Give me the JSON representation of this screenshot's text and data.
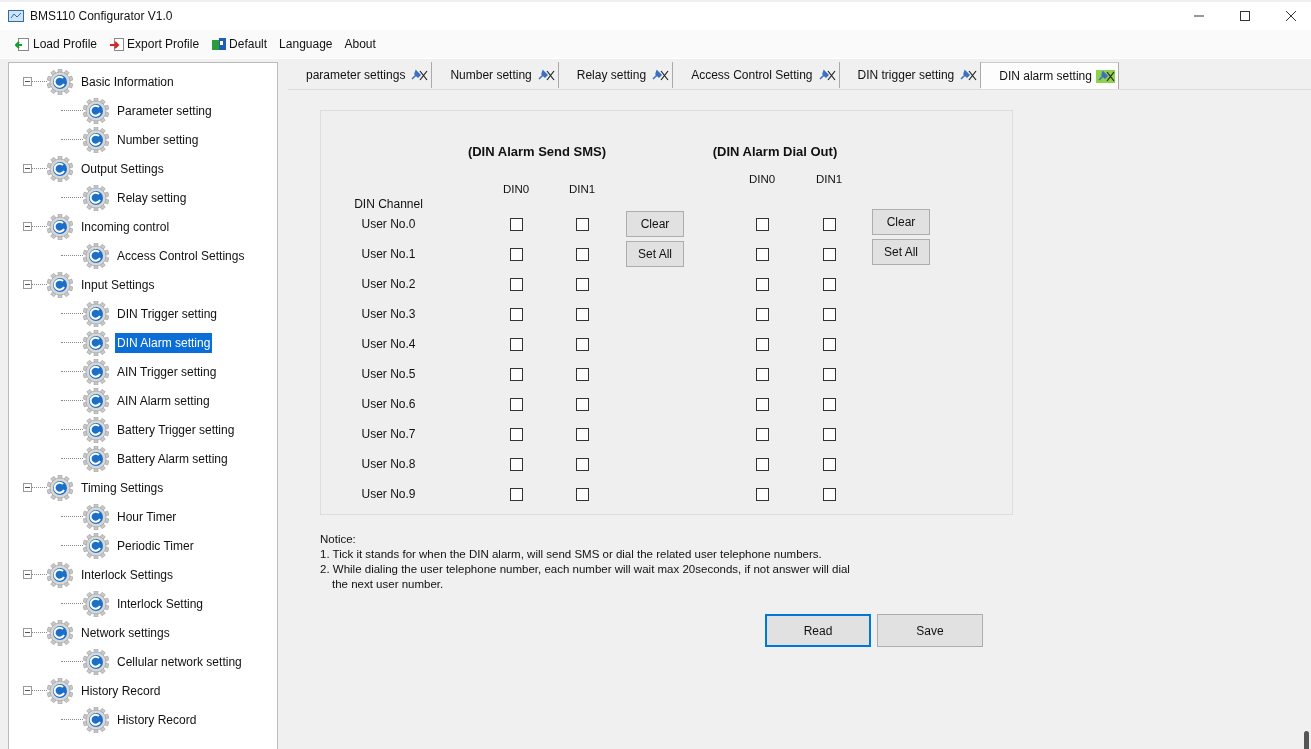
{
  "window": {
    "title": "BMS110 Configurator V1.0"
  },
  "toolbar": [
    {
      "label": "Load Profile",
      "kind": "load"
    },
    {
      "label": "Export Profile",
      "kind": "export"
    },
    {
      "label": "Default",
      "kind": "default"
    },
    {
      "label": "Language",
      "kind": "menu"
    },
    {
      "label": "About",
      "kind": "menu"
    }
  ],
  "tree": [
    {
      "label": "Basic Information",
      "expanded": true,
      "selected": false,
      "children": [
        {
          "label": "Parameter setting",
          "selected": false
        },
        {
          "label": "Number setting",
          "selected": false
        }
      ]
    },
    {
      "label": "Output Settings",
      "expanded": true,
      "selected": false,
      "children": [
        {
          "label": "Relay setting",
          "selected": false
        }
      ]
    },
    {
      "label": "Incoming control",
      "expanded": true,
      "selected": false,
      "children": [
        {
          "label": "Access Control Settings",
          "selected": false
        }
      ]
    },
    {
      "label": "Input Settings",
      "expanded": true,
      "selected": false,
      "children": [
        {
          "label": "DIN Trigger setting",
          "selected": false
        },
        {
          "label": "DIN Alarm setting",
          "selected": true
        },
        {
          "label": "AIN Trigger setting",
          "selected": false
        },
        {
          "label": "AIN Alarm setting",
          "selected": false
        },
        {
          "label": "Battery Trigger setting",
          "selected": false
        },
        {
          "label": "Battery Alarm setting",
          "selected": false
        }
      ]
    },
    {
      "label": "Timing Settings",
      "expanded": true,
      "selected": false,
      "children": [
        {
          "label": "Hour Timer",
          "selected": false
        },
        {
          "label": "Periodic Timer",
          "selected": false
        }
      ]
    },
    {
      "label": "Interlock Settings",
      "expanded": true,
      "selected": false,
      "children": [
        {
          "label": "Interlock Setting",
          "selected": false
        }
      ]
    },
    {
      "label": "Network settings",
      "expanded": true,
      "selected": false,
      "children": [
        {
          "label": "Cellular network setting",
          "selected": false
        }
      ]
    },
    {
      "label": "History Record",
      "expanded": true,
      "selected": false,
      "children": [
        {
          "label": "History Record",
          "selected": false
        }
      ]
    }
  ],
  "tabs": [
    {
      "label": "parameter settings",
      "selected": false
    },
    {
      "label": "Number setting",
      "selected": false
    },
    {
      "label": "Relay setting",
      "selected": false
    },
    {
      "label": "Access Control Setting",
      "selected": false
    },
    {
      "label": "DIN trigger setting",
      "selected": false
    },
    {
      "label": "DIN alarm setting",
      "selected": true
    }
  ],
  "form": {
    "row_header": "DIN Channel",
    "sections": [
      {
        "title": "(DIN Alarm Send SMS)",
        "columns": [
          "DIN0",
          "DIN1"
        ],
        "buttons": [
          "Clear",
          "Set All"
        ]
      },
      {
        "title": "(DIN Alarm Dial Out)",
        "columns": [
          "DIN0",
          "DIN1"
        ],
        "buttons": [
          "Clear",
          "Set All"
        ]
      }
    ],
    "rows": [
      {
        "label": "User No.0",
        "checked": [
          [
            false,
            false
          ],
          [
            false,
            false
          ]
        ]
      },
      {
        "label": "User No.1",
        "checked": [
          [
            false,
            false
          ],
          [
            false,
            false
          ]
        ]
      },
      {
        "label": "User No.2",
        "checked": [
          [
            false,
            false
          ],
          [
            false,
            false
          ]
        ]
      },
      {
        "label": "User No.3",
        "checked": [
          [
            false,
            false
          ],
          [
            false,
            false
          ]
        ]
      },
      {
        "label": "User No.4",
        "checked": [
          [
            false,
            false
          ],
          [
            false,
            false
          ]
        ]
      },
      {
        "label": "User No.5",
        "checked": [
          [
            false,
            false
          ],
          [
            false,
            false
          ]
        ]
      },
      {
        "label": "User No.6",
        "checked": [
          [
            false,
            false
          ],
          [
            false,
            false
          ]
        ]
      },
      {
        "label": "User No.7",
        "checked": [
          [
            false,
            false
          ],
          [
            false,
            false
          ]
        ]
      },
      {
        "label": "User No.8",
        "checked": [
          [
            false,
            false
          ],
          [
            false,
            false
          ]
        ]
      },
      {
        "label": "User No.9",
        "checked": [
          [
            false,
            false
          ],
          [
            false,
            false
          ]
        ]
      }
    ]
  },
  "notice": {
    "title": "Notice:",
    "lines": [
      "1. Tick it stands for when the DIN alarm, will send SMS or dial the related user telephone numbers.",
      "2. While dialing the user telephone number, each number will wait max 20seconds, if not answer will dial the next user number."
    ]
  },
  "actions": [
    {
      "label": "Read",
      "focused": true
    },
    {
      "label": "Save",
      "focused": false
    }
  ]
}
